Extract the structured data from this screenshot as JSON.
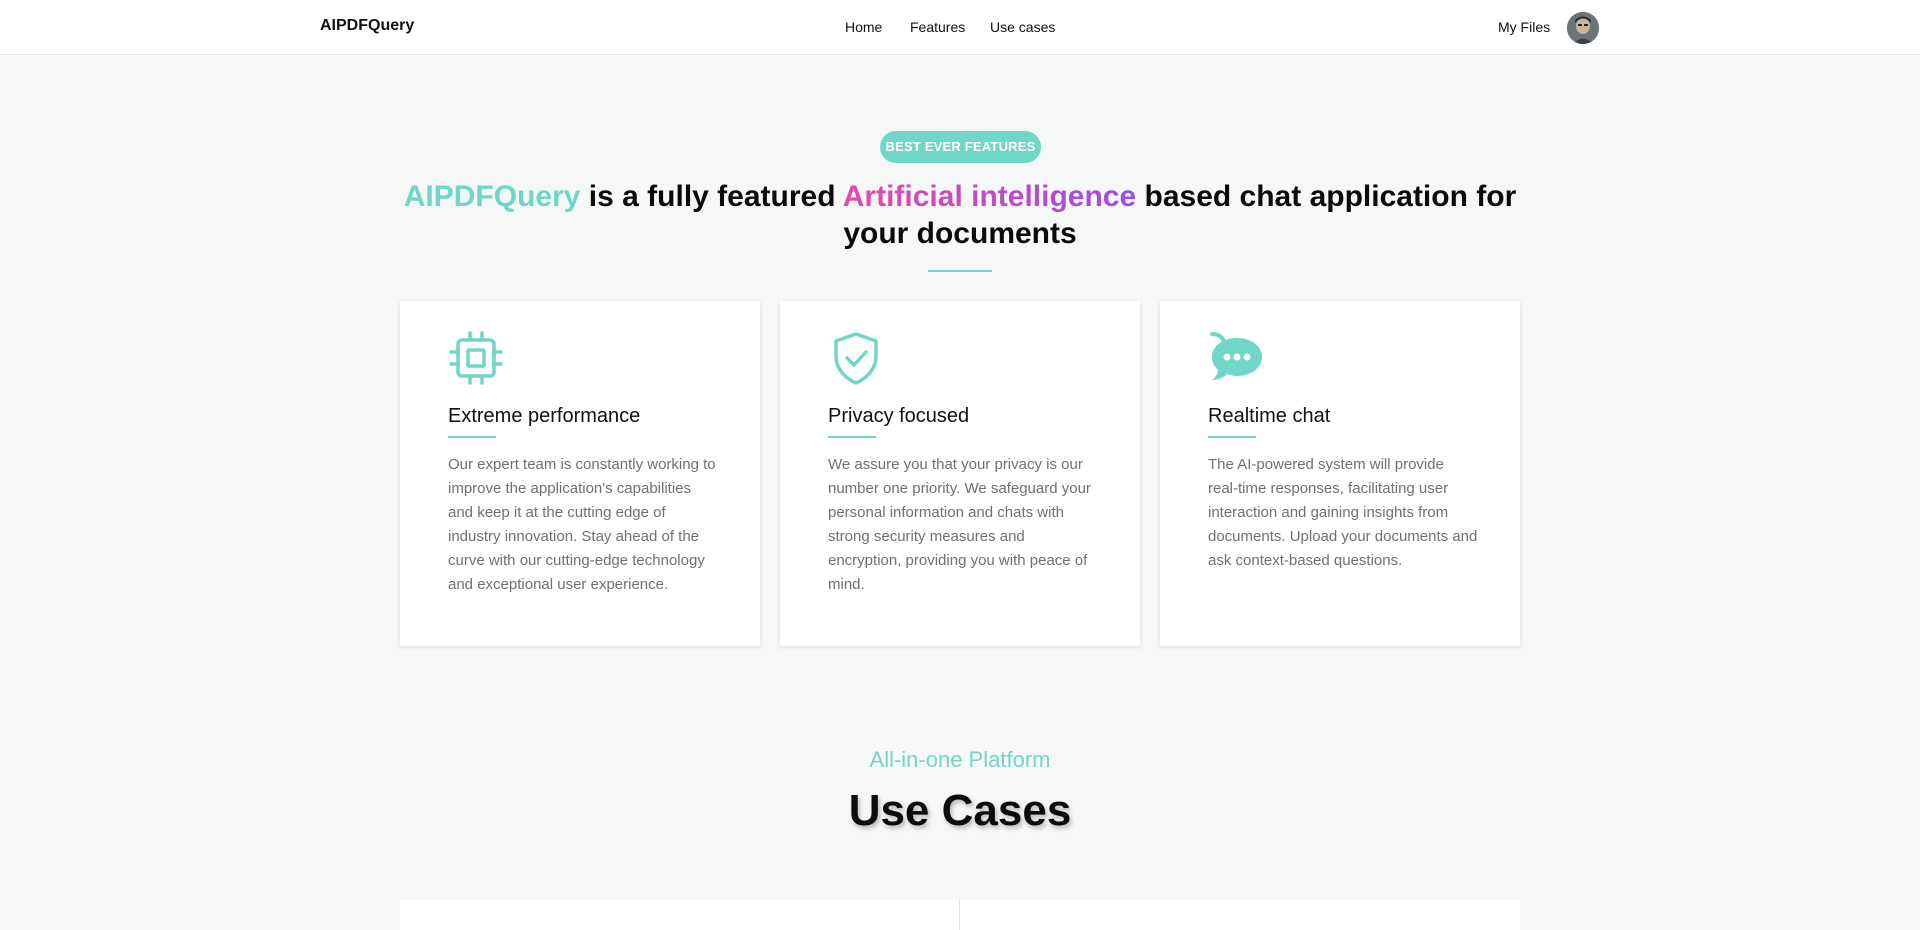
{
  "header": {
    "brand": "AIPDFQuery",
    "nav": [
      "Home",
      "Features",
      "Use cases"
    ],
    "my_files": "My Files"
  },
  "hero": {
    "badge": "BEST EVER FEATURES",
    "headline_brand": "AIPDFQuery",
    "headline_mid": " is a fully featured ",
    "headline_ai": "Artificial intelligence",
    "headline_end": " based chat application for your documents"
  },
  "features": [
    {
      "icon": "cpu-icon",
      "title": "Extreme performance",
      "description": "Our expert team is constantly working to improve the application's capabilities and keep it at the cutting edge of industry innovation. Stay ahead of the curve with our cutting-edge technology and exceptional user experience."
    },
    {
      "icon": "shield-check-icon",
      "title": "Privacy focused",
      "description": "We assure you that your privacy is our number one priority. We safeguard your personal information and chats with strong security measures and encryption, providing you with peace of mind."
    },
    {
      "icon": "chat-bubble-icon",
      "title": "Realtime chat",
      "description": "The AI-powered system will provide real-time responses, facilitating user interaction and gaining insights from documents. Upload your documents and ask context-based questions."
    }
  ],
  "use_cases": {
    "eyebrow": "All-in-one Platform",
    "title": "Use Cases"
  },
  "colors": {
    "accent": "#6fd6c8",
    "gradient_start": "#e64aa3",
    "gradient_end": "#9b4fe6",
    "background": "#f6f8f8"
  }
}
